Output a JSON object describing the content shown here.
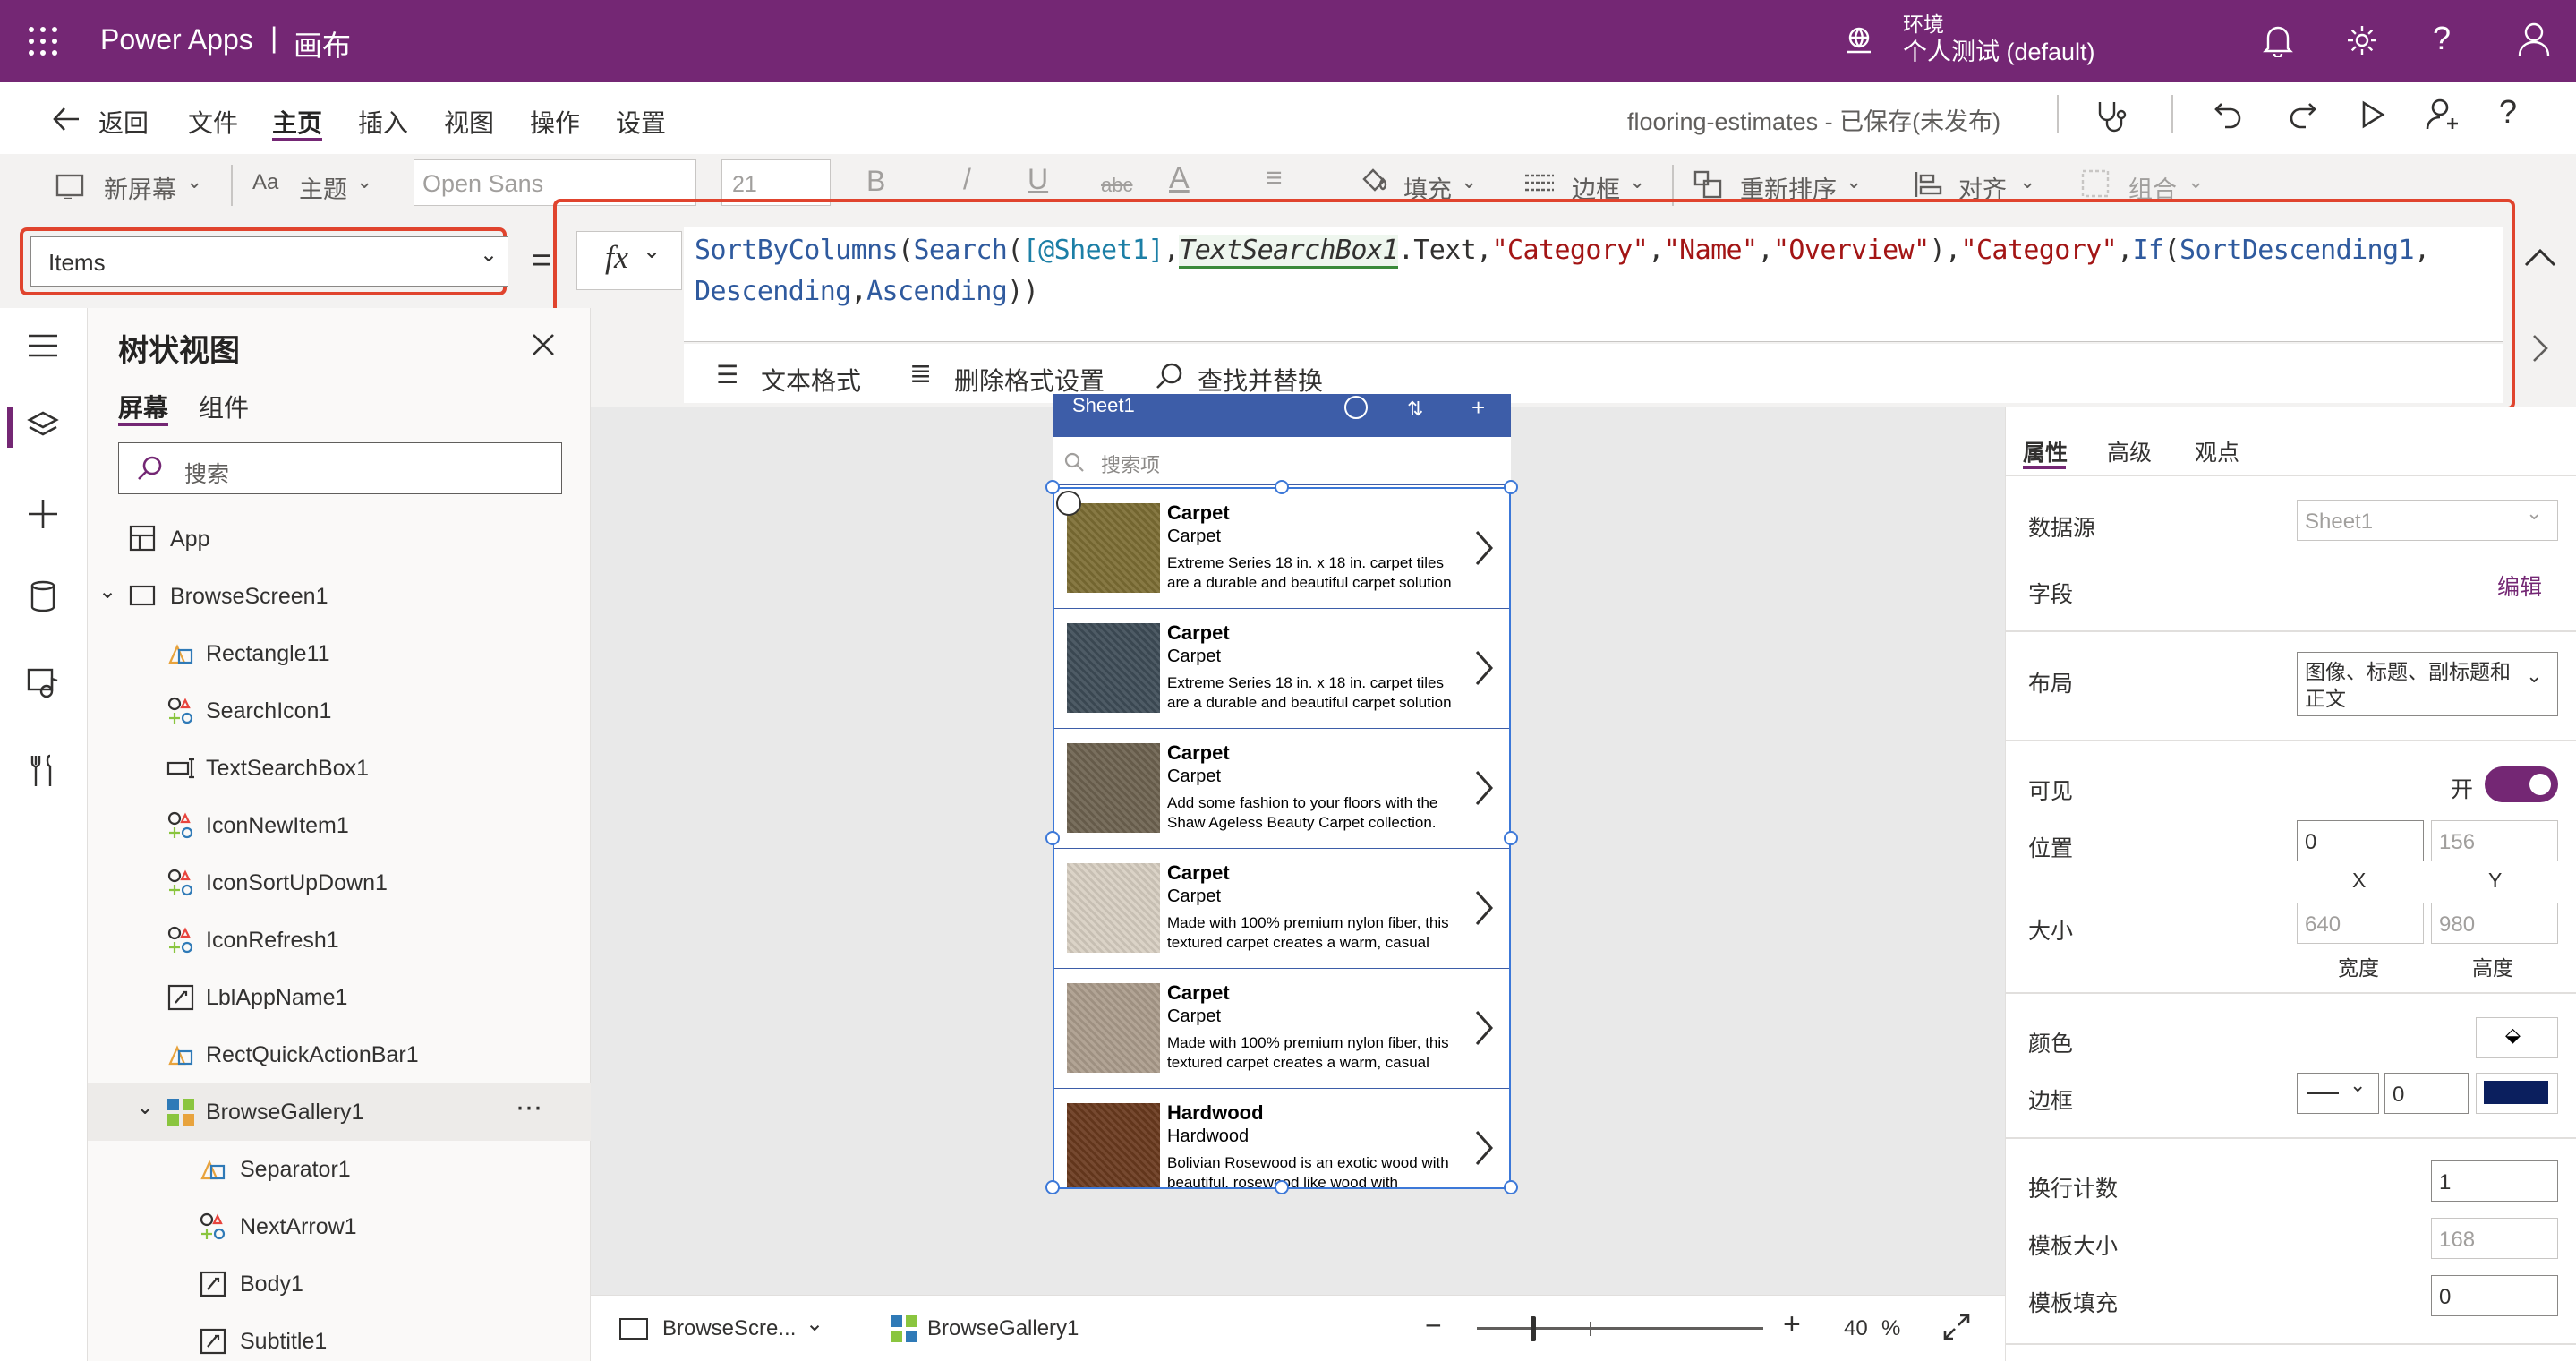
{
  "topbar": {
    "app_name": "Power Apps",
    "separator": "|",
    "mode": "画布",
    "env_label": "环境",
    "env_name": "个人测试 (default)"
  },
  "menubar": {
    "back": "返回",
    "items": [
      "文件",
      "主页",
      "插入",
      "视图",
      "操作",
      "设置"
    ],
    "active": "主页",
    "app_title": "flooring-estimates - 已保存(未发布)"
  },
  "toolbar": {
    "new_screen": "新屏幕",
    "theme": "主题",
    "font": "Open Sans",
    "font_size": "21",
    "bold": "B",
    "italic": "/",
    "underline": "U",
    "strike": "abc",
    "font_color": "A",
    "fill": "填充",
    "border": "边框",
    "reorder": "重新排序",
    "align": "对齐",
    "group": "组合"
  },
  "formula": {
    "property": "Items",
    "equals": "=",
    "fx": "fx",
    "tokens_line1": [
      {
        "t": "SortByColumns",
        "c": "fn"
      },
      {
        "t": "(",
        "c": "p"
      },
      {
        "t": "Search",
        "c": "fn"
      },
      {
        "t": "(",
        "c": "p"
      },
      {
        "t": "[@Sheet1]",
        "c": "ds"
      },
      {
        "t": ",",
        "c": "p"
      },
      {
        "t": "TextSearchBox1",
        "c": "ctl"
      },
      {
        "t": ".Text",
        "c": "p"
      },
      {
        "t": ",",
        "c": "p"
      },
      {
        "t": "\"Category\"",
        "c": "str"
      },
      {
        "t": ",",
        "c": "p"
      },
      {
        "t": "\"Name\"",
        "c": "str"
      },
      {
        "t": ",",
        "c": "p"
      },
      {
        "t": "\"Overview\"",
        "c": "str"
      },
      {
        "t": ")",
        "c": "p"
      },
      {
        "t": ",",
        "c": "p"
      },
      {
        "t": "\"Category\"",
        "c": "str"
      },
      {
        "t": ",",
        "c": "p"
      },
      {
        "t": "If",
        "c": "fn"
      },
      {
        "t": "(",
        "c": "p"
      },
      {
        "t": "SortDescending1",
        "c": "fn"
      },
      {
        "t": ",",
        "c": "p"
      }
    ],
    "tokens_line2": [
      {
        "t": "Descending",
        "c": "fn"
      },
      {
        "t": ",",
        "c": "p"
      },
      {
        "t": "Ascending",
        "c": "fn"
      },
      {
        "t": "))",
        "c": "p"
      }
    ],
    "format_text": "文本格式",
    "remove_format": "删除格式设置",
    "find_replace": "查找并替换"
  },
  "tree": {
    "title": "树状视图",
    "tabs": [
      "屏幕",
      "组件"
    ],
    "search_placeholder": "搜索",
    "nodes": [
      {
        "label": "App",
        "indent": 0,
        "icon": "app-icon"
      },
      {
        "label": "BrowseScreen1",
        "indent": 0,
        "icon": "screen-icon",
        "expand": true
      },
      {
        "label": "Rectangle11",
        "indent": 1,
        "icon": "shape-icon"
      },
      {
        "label": "SearchIcon1",
        "indent": 1,
        "icon": "icon-control-icon"
      },
      {
        "label": "TextSearchBox1",
        "indent": 1,
        "icon": "textinput-icon"
      },
      {
        "label": "IconNewItem1",
        "indent": 1,
        "icon": "icon-control-icon"
      },
      {
        "label": "IconSortUpDown1",
        "indent": 1,
        "icon": "icon-control-icon"
      },
      {
        "label": "IconRefresh1",
        "indent": 1,
        "icon": "icon-control-icon"
      },
      {
        "label": "LblAppName1",
        "indent": 1,
        "icon": "label-icon"
      },
      {
        "label": "RectQuickActionBar1",
        "indent": 1,
        "icon": "shape-icon"
      },
      {
        "label": "BrowseGallery1",
        "indent": 1,
        "icon": "gallery-icon",
        "expand": true,
        "selected": true
      },
      {
        "label": "Separator1",
        "indent": 2,
        "icon": "shape-icon"
      },
      {
        "label": "NextArrow1",
        "indent": 2,
        "icon": "icon-control-icon"
      },
      {
        "label": "Body1",
        "indent": 2,
        "icon": "label-icon"
      },
      {
        "label": "Subtitle1",
        "indent": 2,
        "icon": "label-icon"
      }
    ]
  },
  "phone": {
    "header_title": "Sheet1",
    "search_placeholder": "搜索项",
    "items": [
      {
        "title": "Carpet",
        "subtitle": "Carpet",
        "body": "Extreme Series 18 in. x 18 in. carpet tiles are a durable and beautiful carpet solution specially engineered for both",
        "color": "#7d6e34"
      },
      {
        "title": "Carpet",
        "subtitle": "Carpet",
        "body": "Extreme Series 18 in. x 18 in. carpet tiles are a durable and beautiful carpet solution specially engineered for both",
        "color": "#3f4d58"
      },
      {
        "title": "Carpet",
        "subtitle": "Carpet",
        "body": "Add some fashion to your floors with the Shaw Ageless Beauty Carpet collection.",
        "color": "#6e6350"
      },
      {
        "title": "Carpet",
        "subtitle": "Carpet",
        "body": "Made with 100% premium nylon fiber, this textured carpet creates a warm, casual atmosphere that invites you to",
        "color": "#d8cfc2"
      },
      {
        "title": "Carpet",
        "subtitle": "Carpet",
        "body": "Made with 100% premium nylon fiber, this textured carpet creates a warm, casual atmosphere that invites you to",
        "color": "#ab9c8c"
      },
      {
        "title": "Hardwood",
        "subtitle": "Hardwood",
        "body": "Bolivian Rosewood is an exotic wood with beautiful, rosewood like wood with",
        "color": "#6a3a1e"
      }
    ]
  },
  "props": {
    "tabs": [
      "属性",
      "高级",
      "观点"
    ],
    "datasource_label": "数据源",
    "datasource_value": "Sheet1",
    "fields_label": "字段",
    "fields_edit": "编辑",
    "layout_label": "布局",
    "layout_value": "图像、标题、副标题和正文",
    "visible_label": "可见",
    "visible_value": "开",
    "position_label": "位置",
    "pos_x": "0",
    "pos_y": "156",
    "x_label": "X",
    "y_label": "Y",
    "size_label": "大小",
    "width": "640",
    "height": "980",
    "width_label": "宽度",
    "height_label": "高度",
    "color_label": "颜色",
    "border_label": "边框",
    "border_width": "0",
    "border_color": "#0b1f5e",
    "wrap_label": "换行计数",
    "wrap_value": "1",
    "template_size_label": "模板大小",
    "template_size_value": "168",
    "template_padding_label": "模板填充",
    "template_padding_value": "0"
  },
  "bottom": {
    "screen": "BrowseScre...",
    "gallery": "BrowseGallery1",
    "zoom": "40",
    "percent": "%"
  },
  "colors": {
    "brand": "#742774",
    "accent": "#3d5da8",
    "highlight": "#e0442e"
  }
}
